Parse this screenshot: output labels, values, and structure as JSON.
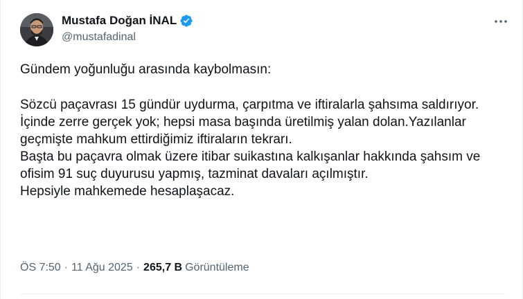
{
  "author": {
    "display_name": "Mustafa Doğan İNAL",
    "handle": "@mustafadinal",
    "verified_color": "#1d9bf0"
  },
  "tweet": {
    "lines": [
      "Gündem yoğunluğu arasında kaybolmasın:",
      "Sözcü paçavrası 15 gündür uydurma, çarpıtma ve iftiralarla şahsıma saldırıyor.",
      "İçinde zerre gerçek yok; hepsi masa başında üretilmiş yalan dolan.Yazılanlar geçmişte mahkum ettirdiğimiz iftiraların tekrarı.",
      "Başta bu paçavra olmak üzere itibar suikastına kalkışanlar hakkında şahsım ve ofisim 91 suç duyurusu yapmış, tazminat davaları açılmıştır.",
      "Hepsiyle mahkemede hesaplaşacaz."
    ]
  },
  "meta": {
    "time": "ÖS 7:50",
    "date": "11 Ağu 2025",
    "separator": "·",
    "views_count": "265,7 B",
    "views_label": "Görüntüleme"
  },
  "icons": {
    "avatar": "avatar-photo",
    "verified": "verified-badge-icon",
    "more": "more-options-icon"
  }
}
